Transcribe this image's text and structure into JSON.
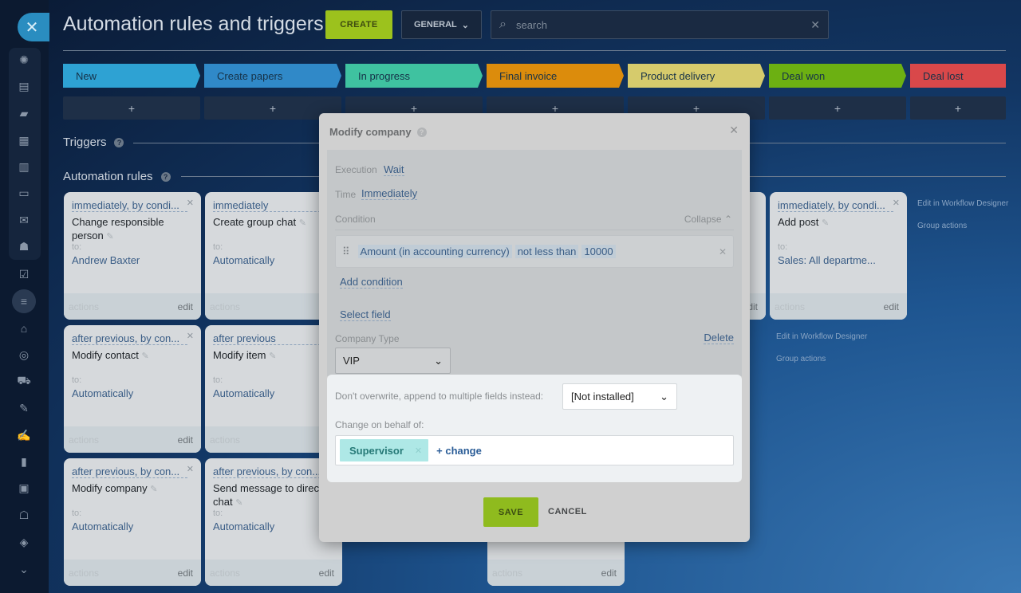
{
  "header": {
    "title": "Automation rules and triggers",
    "create": "CREATE",
    "general": "GENERAL",
    "search_placeholder": "search"
  },
  "stages": [
    {
      "label": "New",
      "color": "#2ea2d3"
    },
    {
      "label": "Create papers",
      "color": "#3089c8"
    },
    {
      "label": "In progress",
      "color": "#3fc2a0"
    },
    {
      "label": "Final invoice",
      "color": "#dc8c0c"
    },
    {
      "label": "Product delivery",
      "color": "#d6cb6c"
    },
    {
      "label": "Deal won",
      "color": "#6cb012"
    },
    {
      "label": "Deal lost",
      "color": "#d9484a"
    }
  ],
  "plus": "+",
  "sections": {
    "triggers": "Triggers",
    "rules": "Automation rules",
    "help": "?"
  },
  "cards": [
    {
      "when": "immediately, by condi...",
      "name": "Change responsible person",
      "to": "to:",
      "target": "Andrew Baxter",
      "actions": "actions",
      "edit": "edit"
    },
    {
      "when": "immediately",
      "name": "Create group chat",
      "to": "to:",
      "target": "Automatically",
      "actions": "actions",
      "edit": "edit"
    },
    {
      "when": "immediately, by condi...",
      "name": "Add post",
      "to": "to:",
      "target": "Sales: All departme...",
      "actions": "actions",
      "edit": "edit"
    },
    {
      "when": "after previous, by con...",
      "name": "Modify contact",
      "to": "to:",
      "target": "Automatically",
      "actions": "actions",
      "edit": "edit"
    },
    {
      "when": "after previous",
      "name": "Modify item",
      "to": "to:",
      "target": "Automatically",
      "actions": "actions",
      "edit": "edit"
    },
    {
      "when": "after previous, by con...",
      "name": "Modify company",
      "to": "to:",
      "target": "Automatically",
      "actions": "actions",
      "edit": "edit"
    },
    {
      "when": "after previous, by con...",
      "name": "Send message to direct chat",
      "to": "to:",
      "target": "Automatically",
      "actions": "actions",
      "edit": "edit"
    },
    {
      "actions": "actions",
      "edit": "edit"
    },
    {
      "actions": "actions",
      "edit": "edit"
    }
  ],
  "side_links": {
    "designer": "Edit in Workflow Designer",
    "group": "Group actions"
  },
  "modal": {
    "title": "Modify company",
    "execution_label": "Execution",
    "execution_value": "Wait",
    "time_label": "Time",
    "time_value": "Immediately",
    "condition_label": "Condition",
    "collapse": "Collapse",
    "condition": {
      "field": "Amount (in accounting currency)",
      "operator": "not less than",
      "value": "10000"
    },
    "add_condition": "Add condition",
    "select_field": "Select field",
    "field_label": "Company Type",
    "delete": "Delete",
    "field_value": "VIP",
    "append_label": "Don't overwrite, append to multiple fields instead:",
    "append_value": "[Not installed]",
    "behalf_label": "Change on behalf of:",
    "behalf_value": "Supervisor",
    "change": "+ change",
    "save": "SAVE",
    "cancel": "CANCEL"
  }
}
